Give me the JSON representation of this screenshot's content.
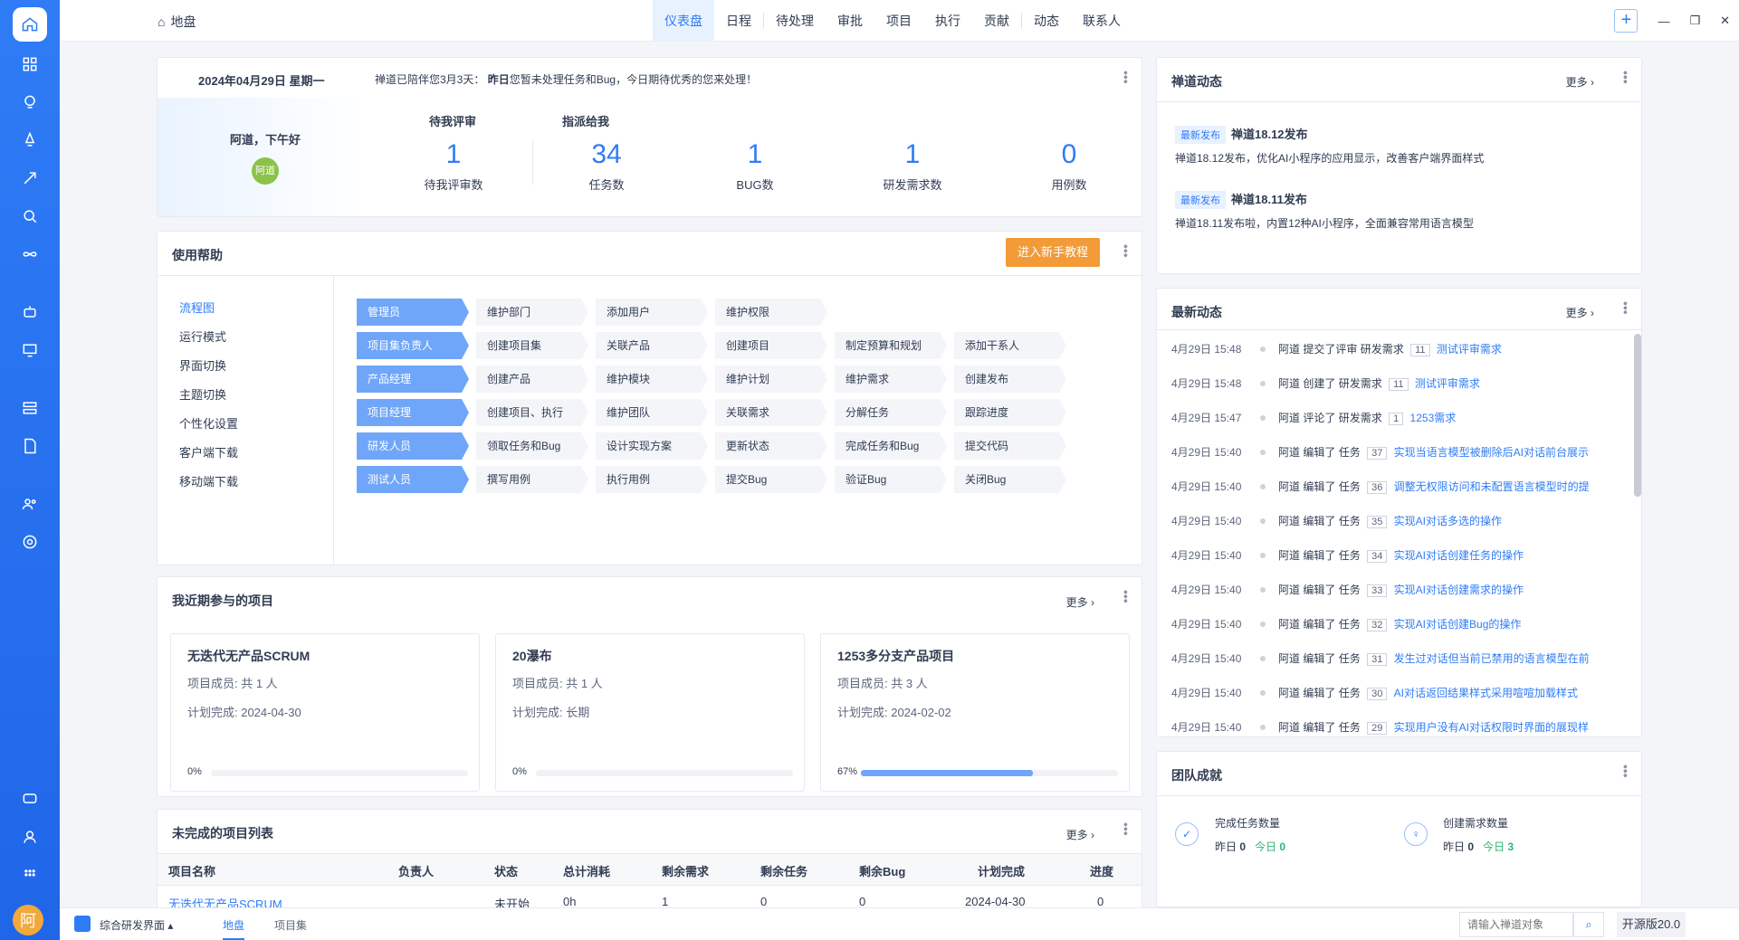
{
  "colors": {
    "accent": "#2f7cf6",
    "orange": "#f39b38",
    "green": "#2bb673"
  },
  "breadcrumb": {
    "label": "地盘"
  },
  "topnav": [
    "仪表盘",
    "日程",
    "待处理",
    "审批",
    "项目",
    "执行",
    "贡献",
    "动态",
    "联系人"
  ],
  "welcome": {
    "date": "2024年04月29日 星期一",
    "message": "禅道已陪伴您3月3天：",
    "msg_bold": "昨日",
    "msg_rest": "您暂未处理任务和Bug，今日期待优秀的您来处理！",
    "greeting": "阿道，下午好",
    "avatar": "阿道",
    "label_review": "待我评审",
    "label_assigned": "指派给我",
    "stats": [
      {
        "num": "1",
        "label": "待我评审数"
      },
      {
        "num": "34",
        "label": "任务数"
      },
      {
        "num": "1",
        "label": "BUG数"
      },
      {
        "num": "1",
        "label": "研发需求数"
      },
      {
        "num": "0",
        "label": "用例数"
      }
    ]
  },
  "help": {
    "title": "使用帮助",
    "button": "进入新手教程",
    "menu": [
      "流程图",
      "运行模式",
      "界面切换",
      "主题切换",
      "个性化设置",
      "客户端下载",
      "移动端下载"
    ],
    "rows": [
      {
        "role": "管理员",
        "steps": [
          "维护部门",
          "添加用户",
          "维护权限"
        ]
      },
      {
        "role": "项目集负责人",
        "steps": [
          "创建项目集",
          "关联产品",
          "创建项目",
          "制定预算和规划",
          "添加干系人"
        ]
      },
      {
        "role": "产品经理",
        "steps": [
          "创建产品",
          "维护模块",
          "维护计划",
          "维护需求",
          "创建发布"
        ]
      },
      {
        "role": "项目经理",
        "steps": [
          "创建项目、执行",
          "维护团队",
          "关联需求",
          "分解任务",
          "跟踪进度"
        ]
      },
      {
        "role": "研发人员",
        "steps": [
          "领取任务和Bug",
          "设计实现方案",
          "更新状态",
          "完成任务和Bug",
          "提交代码"
        ]
      },
      {
        "role": "测试人员",
        "steps": [
          "撰写用例",
          "执行用例",
          "提交Bug",
          "验证Bug",
          "关闭Bug"
        ]
      }
    ]
  },
  "projects": {
    "title": "我近期参与的项目",
    "more": "更多",
    "cards": [
      {
        "name": "无迭代无产品SCRUM",
        "members": "项目成员:  共 1 人",
        "date": "计划完成:  2024-04-30",
        "progress": "0%",
        "pct": 0
      },
      {
        "name": "20瀑布",
        "members": "项目成员:  共 1 人",
        "date": "计划完成:  长期",
        "progress": "0%",
        "pct": 0
      },
      {
        "name": "1253多分支产品项目",
        "members": "项目成员:  共 3 人",
        "date": "计划完成:  2024-02-02",
        "progress": "67%",
        "pct": 67
      }
    ]
  },
  "projlist": {
    "title": "未完成的项目列表",
    "more": "更多",
    "headers": [
      "项目名称",
      "负责人",
      "状态",
      "总计消耗",
      "剩余需求",
      "剩余任务",
      "剩余Bug",
      "计划完成",
      "进度"
    ],
    "row": [
      "无迭代无产品SCRUM",
      "",
      "未开始",
      "0h",
      "1",
      "0",
      "0",
      "2024-04-30",
      "0"
    ]
  },
  "news": {
    "title": "禅道动态",
    "more": "更多",
    "items": [
      {
        "tag": "最新发布",
        "title": "禅道18.12发布",
        "desc": "禅道18.12发布，优化AI小程序的应用显示，改善客户端界面样式"
      },
      {
        "tag": "最新发布",
        "title": "禅道18.11发布",
        "desc": "禅道18.11发布啦，内置12种AI小程序，全面兼容常用语言模型"
      }
    ]
  },
  "dynamics": {
    "title": "最新动态",
    "more": "更多",
    "rows": [
      {
        "time": "4月29日 15:48",
        "user": "阿道",
        "action": "提交了评审",
        "type": "研发需求",
        "id": "11",
        "link": "测试评审需求"
      },
      {
        "time": "4月29日 15:48",
        "user": "阿道",
        "action": "创建了",
        "type": "研发需求",
        "id": "11",
        "link": "测试评审需求"
      },
      {
        "time": "4月29日 15:47",
        "user": "阿道",
        "action": "评论了",
        "type": "研发需求",
        "id": "1",
        "link": "1253需求"
      },
      {
        "time": "4月29日 15:40",
        "user": "阿道",
        "action": "编辑了",
        "type": "任务",
        "id": "37",
        "link": "实现当语言模型被删除后AI对话前台展示"
      },
      {
        "time": "4月29日 15:40",
        "user": "阿道",
        "action": "编辑了",
        "type": "任务",
        "id": "36",
        "link": "调整无权限访问和未配置语言模型时的提"
      },
      {
        "time": "4月29日 15:40",
        "user": "阿道",
        "action": "编辑了",
        "type": "任务",
        "id": "35",
        "link": "实现AI对话多选的操作"
      },
      {
        "time": "4月29日 15:40",
        "user": "阿道",
        "action": "编辑了",
        "type": "任务",
        "id": "34",
        "link": "实现AI对话创建任务的操作"
      },
      {
        "time": "4月29日 15:40",
        "user": "阿道",
        "action": "编辑了",
        "type": "任务",
        "id": "33",
        "link": "实现AI对话创建需求的操作"
      },
      {
        "time": "4月29日 15:40",
        "user": "阿道",
        "action": "编辑了",
        "type": "任务",
        "id": "32",
        "link": "实现AI对话创建Bug的操作"
      },
      {
        "time": "4月29日 15:40",
        "user": "阿道",
        "action": "编辑了",
        "type": "任务",
        "id": "31",
        "link": "发生过对话但当前已禁用的语言模型在前"
      },
      {
        "time": "4月29日 15:40",
        "user": "阿道",
        "action": "编辑了",
        "type": "任务",
        "id": "30",
        "link": "AI对话返回结果样式采用喧喧加载样式"
      },
      {
        "time": "4月29日 15:40",
        "user": "阿道",
        "action": "编辑了",
        "type": "任务",
        "id": "29",
        "link": "实现用户没有AI对话权限时界面的展现样"
      }
    ]
  },
  "team": {
    "title": "团队成就",
    "a_label": "完成任务数量",
    "a_yest": "昨日",
    "a_yv": "0",
    "a_today": "今日",
    "a_tv": "0",
    "b_label": "创建需求数量",
    "b_yest": "昨日",
    "b_yv": "0",
    "b_today": "今日",
    "b_tv": "3"
  },
  "status": {
    "app": "综合研发界面",
    "tab1": "地盘",
    "tab2": "项目集",
    "search_placeholder": "请输入禅道对象",
    "version": "开源版20.0"
  },
  "avatar_char": "阿"
}
